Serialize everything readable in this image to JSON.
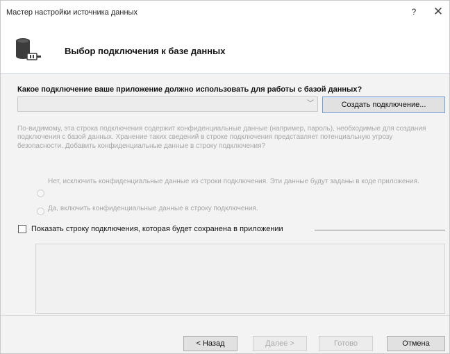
{
  "window": {
    "title": "Мастер настройки источника данных",
    "help_label": "?",
    "close_label": "✕"
  },
  "header": {
    "title": "Выбор подключения к базе данных",
    "icon": "database-connection-icon"
  },
  "main": {
    "question": "Какое подключение ваше приложение должно использовать для работы с базой данных?",
    "connection_combo": {
      "value": "",
      "arrow": "﹀"
    },
    "create_button_label": "Создать подключение...",
    "warning_text": "По-видимому, эта строка подключения содержит конфиденциальные данные (например, пароль), необходимые для создания подключения с базой данных. Хранение таких сведений в строке подключения представляет потенциальную угрозу безопасности. Добавить конфиденциальные данные в строку подключения?",
    "radio_exclude_label": "Нет, исключить конфиденциальные данные из строки подключения. Эти данные будут заданы в коде приложения.",
    "radio_include_label": "Да, включить конфиденциальные данные в строку подключения.",
    "show_connection_string_label": "Показать строку подключения, которая будет сохранена в приложении",
    "show_connection_string_checked": false
  },
  "footer": {
    "back_label": "< Назад",
    "next_label": "Далее >",
    "finish_label": "Готово",
    "cancel_label": "Отмена"
  },
  "colors": {
    "content_background": "#f3f3f3",
    "disabled_text": "#a6a6a6",
    "create_button_border": "#7a9bc4"
  }
}
